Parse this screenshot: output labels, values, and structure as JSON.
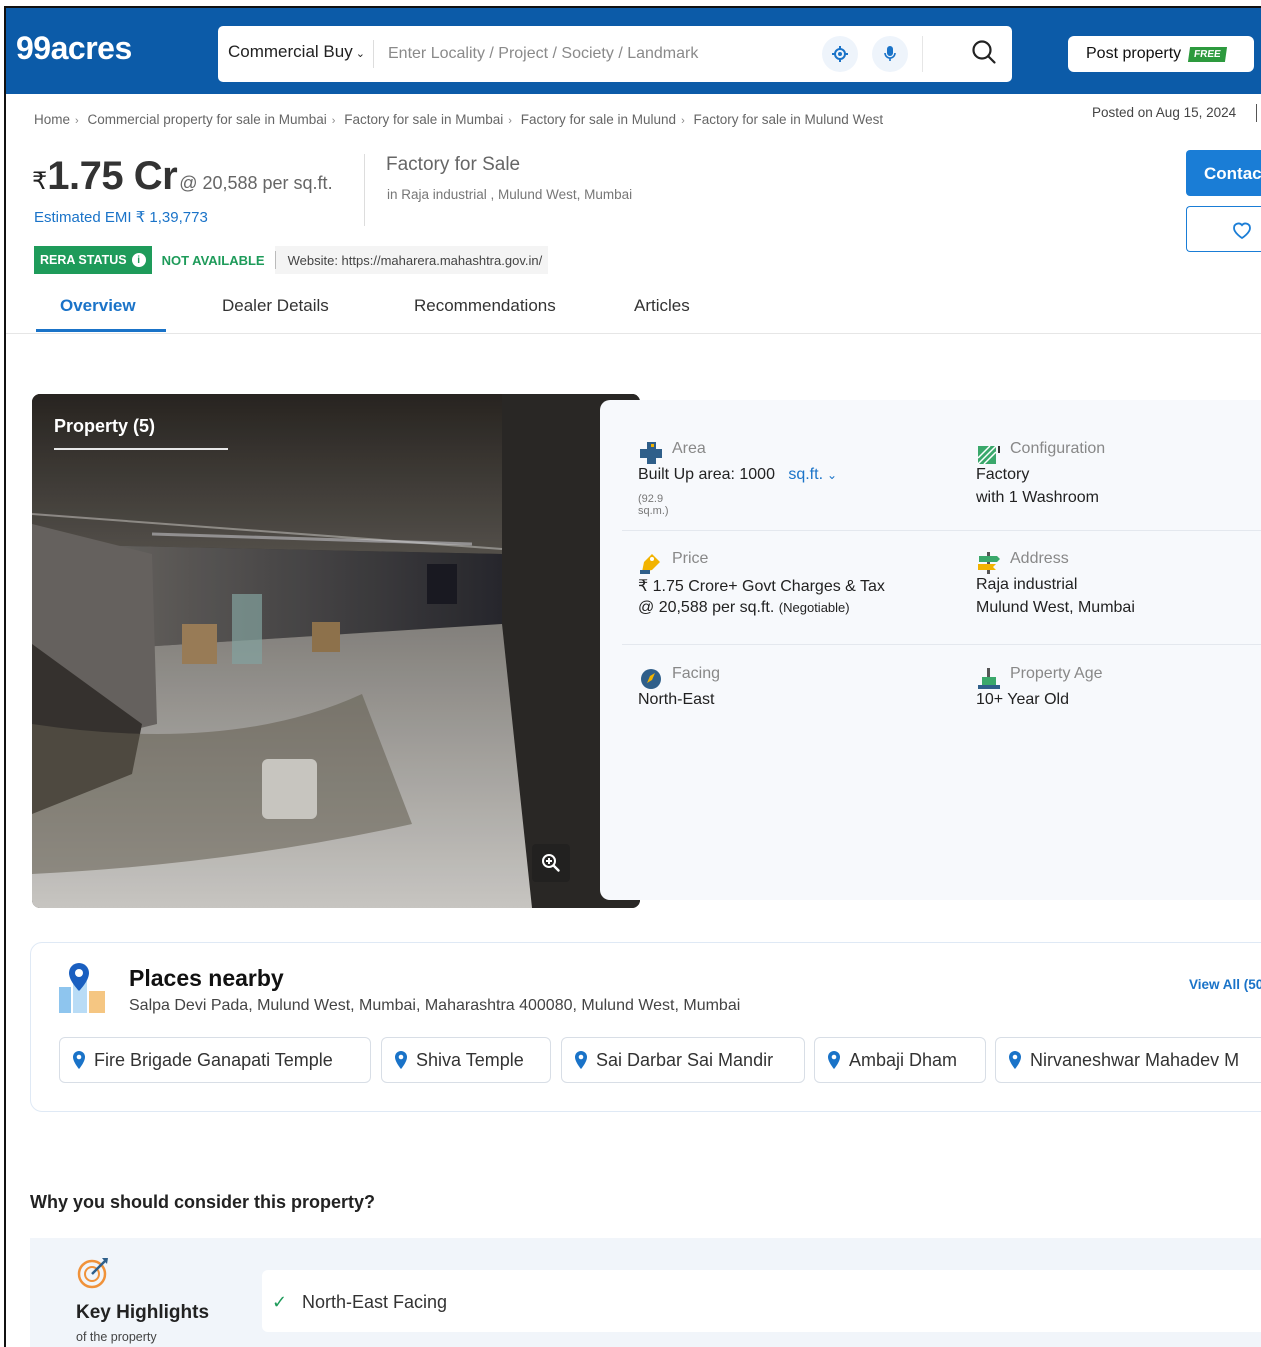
{
  "header": {
    "logo": "99acres",
    "category": "Commercial Buy",
    "search_placeholder": "Enter Locality / Project / Society / Landmark",
    "post_property": "Post property",
    "free_badge": "FREE"
  },
  "breadcrumb": [
    "Home",
    "Commercial property for sale in Mumbai",
    "Factory for sale in Mumbai",
    "Factory for sale in Mulund",
    "Factory for sale in Mulund West"
  ],
  "posted_on": "Posted on Aug 15, 2024",
  "listing": {
    "currency": "₹",
    "price": "1.75 Cr",
    "per_sqft": "@ 20,588 per sq.ft.",
    "emi": "Estimated EMI ₹ 1,39,773",
    "title": "Factory for Sale",
    "location": "in Raja industrial , Mulund West, Mumbai",
    "contact_label": "Contact"
  },
  "rera": {
    "status_label": "RERA STATUS",
    "status_value": "NOT AVAILABLE",
    "website": "Website: https://maharera.mahashtra.gov.in/"
  },
  "tabs": [
    "Overview",
    "Dealer Details",
    "Recommendations",
    "Articles"
  ],
  "photo": {
    "label": "Property (5)"
  },
  "details": {
    "area": {
      "label": "Area",
      "value": "Built Up area: 1000",
      "unit": "sq.ft.",
      "sub": "(92.9 sq.m.)"
    },
    "configuration": {
      "label": "Configuration",
      "line1": "Factory",
      "line2": "with 1 Washroom"
    },
    "price": {
      "label": "Price",
      "line1": "₹ 1.75 Crore+ Govt Charges & Tax",
      "line2": "@ 20,588 per sq.ft.",
      "note": "(Negotiable)"
    },
    "address": {
      "label": "Address",
      "line1": "Raja industrial",
      "line2": "Mulund West, Mumbai"
    },
    "facing": {
      "label": "Facing",
      "value": "North-East"
    },
    "age": {
      "label": "Property Age",
      "value": "10+ Year Old"
    }
  },
  "nearby": {
    "title": "Places nearby",
    "address": "Salpa Devi Pada, Mulund West, Mumbai, Maharashtra 400080, Mulund West, Mumbai",
    "view_all": "View All (50",
    "places": [
      "Fire Brigade Ganapati Temple",
      "Shiva Temple",
      "Sai Darbar Sai Mandir",
      "Ambaji Dham",
      "Nirvaneshwar Mahadev M"
    ]
  },
  "why": {
    "title": "Why you should consider this property?",
    "key_title": "Key Highlights",
    "key_sub": "of the property",
    "highlight": "North-East Facing"
  },
  "colors": {
    "brand": "#0c5ba8",
    "accent": "#1a73c8",
    "rera_green": "#1e9b5a"
  }
}
